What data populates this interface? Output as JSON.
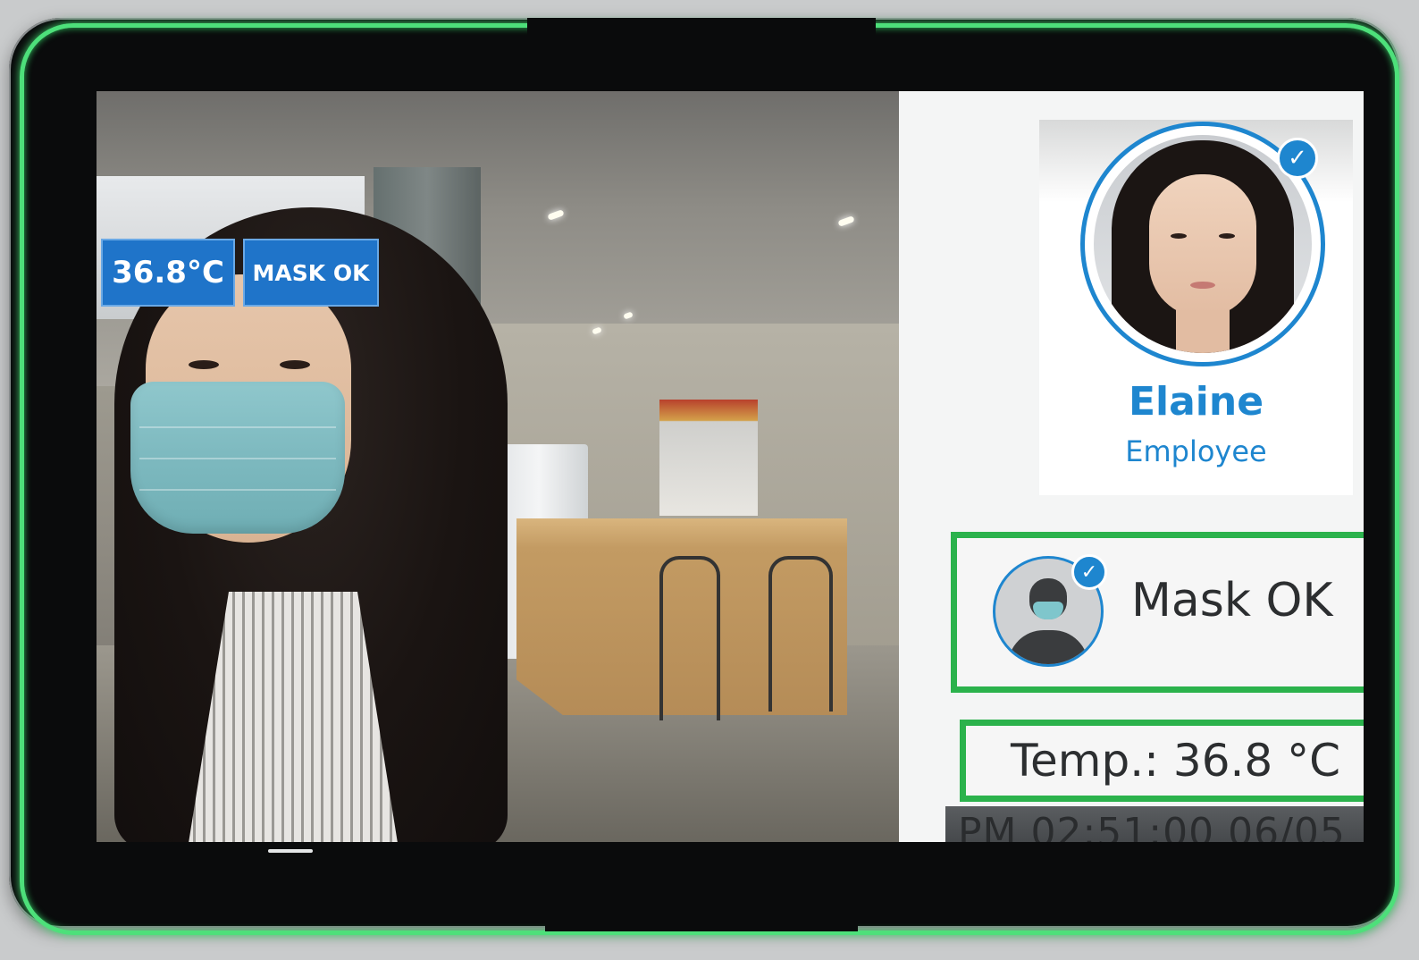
{
  "camera_overlay": {
    "temperature": "36.8°C",
    "mask_status": "MASK OK"
  },
  "profile": {
    "name": "Elaine",
    "role": "Employee",
    "verified_icon": "check-icon"
  },
  "mask_panel": {
    "label": "Mask OK",
    "icon": "masked-person-icon"
  },
  "temp_panel": {
    "label": "Temp.:  36.8 °C"
  },
  "timestamp": {
    "text": "PM 02:51:00 06/05"
  },
  "colors": {
    "accent_blue": "#1e86cf",
    "status_green": "#2bb24c",
    "led_green": "#4de07a"
  }
}
